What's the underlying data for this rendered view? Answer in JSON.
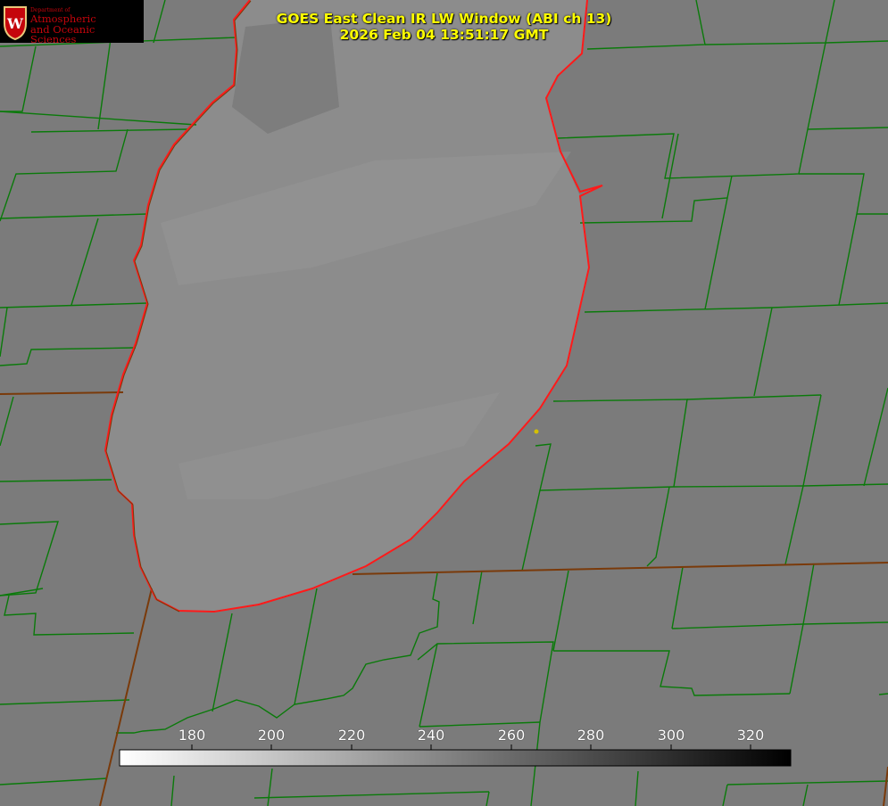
{
  "title": {
    "line1": "GOES East Clean IR LW Window (ABI ch 13)",
    "line2": "2026 Feb 04 13:51:17 GMT"
  },
  "logo": {
    "dept": "Department of",
    "line1": "Atmospheric",
    "line2": "and Oceanic Sciences",
    "emblem": "uw-crest-icon"
  },
  "colorbar": {
    "ticks": [
      "180",
      "200",
      "220",
      "240",
      "260",
      "280",
      "300",
      "320"
    ],
    "range": [
      163,
      330
    ],
    "low_color": "#ffffff",
    "high_color": "#000000"
  },
  "colors": {
    "background": "#7a7a7a",
    "county_lines": "#0a7a0a",
    "state_lines": "#7a3a0a",
    "lake_shore": "#ff1a1a",
    "title": "#ffff00",
    "marker": "#d4c000"
  }
}
